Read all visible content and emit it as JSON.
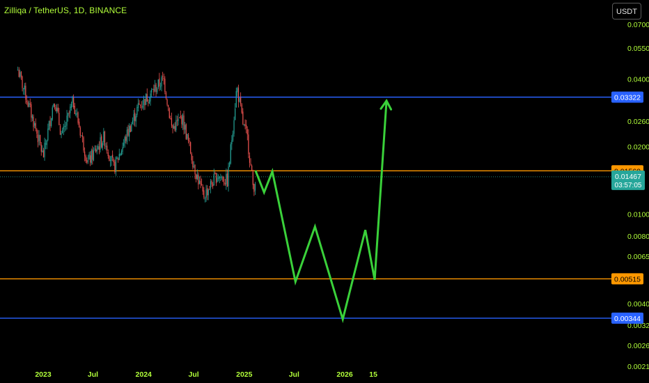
{
  "header": {
    "title": "Zilliqa / TetherUS, 1D, BINANCE",
    "currency_button": "USDT"
  },
  "colors": {
    "background": "#000000",
    "axis_text": "#b2ff3a",
    "candle_up": "#26a69a",
    "candle_down": "#ef5350",
    "blue_line": "#2962ff",
    "orange_line": "#ff9800",
    "projection": "#3ad13a",
    "current_price_tag": "#26a69a"
  },
  "chart_data": {
    "type": "candlestick",
    "symbol": "Zilliqa / TetherUS",
    "interval": "1D",
    "exchange": "BINANCE",
    "scale": "log",
    "ylim": [
      0.0019,
      0.085
    ],
    "y_ticks": [
      "0.07000",
      "0.05500",
      "0.04000",
      "0.02600",
      "0.02000",
      "0.01000",
      "0.00800",
      "0.00650",
      "0.00400",
      "0.00320",
      "0.00260",
      "0.00210"
    ],
    "x_ticks": [
      "2023",
      "Jul",
      "2024",
      "Jul",
      "2025",
      "Jul",
      "2026",
      "15"
    ],
    "horizontal_levels": [
      {
        "value": 0.03322,
        "label": "0.03322",
        "color": "blue"
      },
      {
        "value": 0.0156,
        "label": "0.01560",
        "color": "orange"
      },
      {
        "value": 0.00515,
        "label": "0.00515",
        "color": "orange"
      },
      {
        "value": 0.00344,
        "label": "0.00344",
        "color": "blue"
      }
    ],
    "current_price": {
      "value": 0.01467,
      "label": "0.01467",
      "countdown": "03:57:05"
    },
    "price_path": [
      {
        "date": "2022-10-01",
        "price": 0.044
      },
      {
        "date": "2022-11-01",
        "price": 0.033
      },
      {
        "date": "2022-12-05",
        "price": 0.024
      },
      {
        "date": "2023-01-01",
        "price": 0.018
      },
      {
        "date": "2023-02-10",
        "price": 0.033
      },
      {
        "date": "2023-03-10",
        "price": 0.022
      },
      {
        "date": "2023-04-20",
        "price": 0.032
      },
      {
        "date": "2023-06-12",
        "price": 0.017
      },
      {
        "date": "2023-08-10",
        "price": 0.022
      },
      {
        "date": "2023-09-15",
        "price": 0.016
      },
      {
        "date": "2023-11-10",
        "price": 0.024
      },
      {
        "date": "2023-12-12",
        "price": 0.03
      },
      {
        "date": "2024-03-14",
        "price": 0.04
      },
      {
        "date": "2024-04-13",
        "price": 0.024
      },
      {
        "date": "2024-05-20",
        "price": 0.027
      },
      {
        "date": "2024-07-05",
        "price": 0.016
      },
      {
        "date": "2024-08-05",
        "price": 0.012
      },
      {
        "date": "2024-09-25",
        "price": 0.015
      },
      {
        "date": "2024-11-01",
        "price": 0.014
      },
      {
        "date": "2024-12-05",
        "price": 0.037
      },
      {
        "date": "2024-12-28",
        "price": 0.025
      },
      {
        "date": "2025-01-12",
        "price": 0.022
      },
      {
        "date": "2025-02-03",
        "price": 0.013
      },
      {
        "date": "2025-02-12",
        "price": 0.01467
      }
    ],
    "projection_path": [
      {
        "date": "2025-02-12",
        "price": 0.0155
      },
      {
        "date": "2025-03-14",
        "price": 0.0125
      },
      {
        "date": "2025-04-13",
        "price": 0.0155
      },
      {
        "date": "2025-07-06",
        "price": 0.005
      },
      {
        "date": "2025-09-15",
        "price": 0.0088
      },
      {
        "date": "2025-12-25",
        "price": 0.0034
      },
      {
        "date": "2026-03-17",
        "price": 0.0085
      },
      {
        "date": "2026-04-20",
        "price": 0.0051
      },
      {
        "date": "2026-06-02",
        "price": 0.032
      }
    ]
  }
}
